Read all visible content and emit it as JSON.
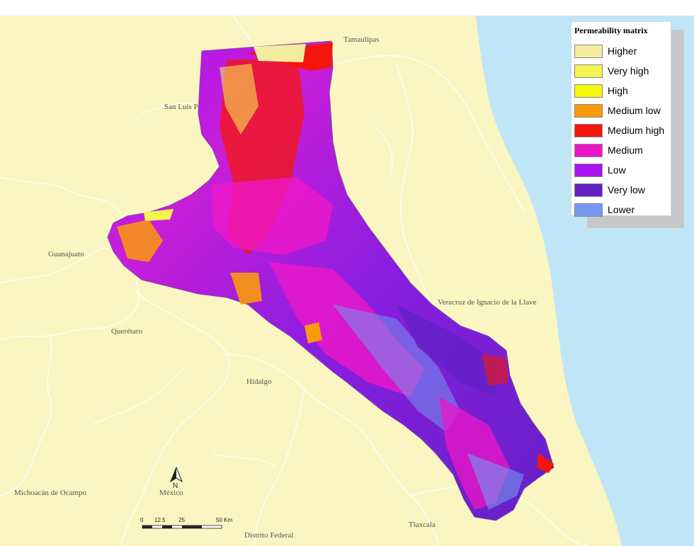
{
  "map": {
    "colors": {
      "land": "#fbf5c1",
      "sea": "#bfe5f7",
      "border": "#ffffff"
    },
    "state_labels": [
      {
        "id": "tamaulipas",
        "text": "Tamaulipas"
      },
      {
        "id": "san-luis-potosi",
        "text": "San Luis P"
      },
      {
        "id": "guanajuato",
        "text": "Guanajuato"
      },
      {
        "id": "queretaro",
        "text": "Querétaro"
      },
      {
        "id": "hidalgo",
        "text": "Hidalgo"
      },
      {
        "id": "veracruz",
        "text": "Veracruz de Ignacio de la Llave"
      },
      {
        "id": "michoacan",
        "text": "Michoacán de Ocampo"
      },
      {
        "id": "mexico",
        "text": "México"
      },
      {
        "id": "distrito-federal",
        "text": "Distrito Federal"
      },
      {
        "id": "tlaxcala",
        "text": "Tlaxcala"
      }
    ]
  },
  "legend": {
    "title": "Permeability matrix",
    "items": [
      {
        "label": "Higher",
        "color": "#f3eda0"
      },
      {
        "label": "Very high",
        "color": "#f6f451"
      },
      {
        "label": "High",
        "color": "#f5f80a"
      },
      {
        "label": "Medium low",
        "color": "#f99a0a"
      },
      {
        "label": "Medium high",
        "color": "#f5150b"
      },
      {
        "label": "Medium",
        "color": "#ee16c8"
      },
      {
        "label": "Low",
        "color": "#a815f0"
      },
      {
        "label": "Very low",
        "color": "#6421c6"
      },
      {
        "label": "Lower",
        "color": "#7597ef"
      }
    ]
  },
  "north_arrow": {
    "letter": "N"
  },
  "scale_bar": {
    "ticks": [
      "0",
      "12.5",
      "25",
      "50 Km"
    ]
  }
}
